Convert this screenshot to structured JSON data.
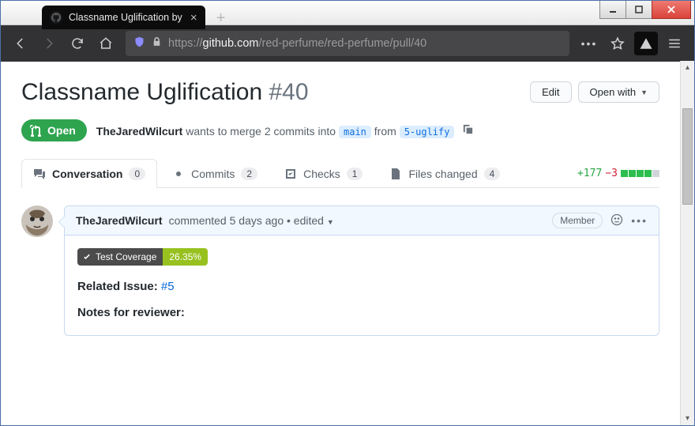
{
  "os_window": {
    "min_tip": "Minimize",
    "max_tip": "Maximize",
    "close_tip": "Close"
  },
  "browser": {
    "tab_title": "Classname Uglification by",
    "url_prefix": "https://",
    "url_host": "github.com",
    "url_path": "/red-perfume/red-perfume/pull/40"
  },
  "pr": {
    "title": "Classname Uglification",
    "number": "#40",
    "edit_label": "Edit",
    "openwith_label": "Open with",
    "state_label": "Open",
    "merge_author": "TheJaredWilcurt",
    "merge_text_1": " wants to merge 2 commits into ",
    "merge_base": "main",
    "merge_text_2": " from ",
    "merge_head": "5-uglify"
  },
  "tabs": {
    "conversation": {
      "label": "Conversation",
      "count": "0"
    },
    "commits": {
      "label": "Commits",
      "count": "2"
    },
    "checks": {
      "label": "Checks",
      "count": "1"
    },
    "files": {
      "label": "Files changed",
      "count": "4"
    },
    "additions": "+177",
    "deletions": "−3"
  },
  "comment": {
    "author": "TheJaredWilcurt",
    "meta_1": " commented ",
    "time": "5 days ago",
    "meta_2": " • edited ",
    "role": "Member",
    "coverage_label": "Test Coverage",
    "coverage_value": "26.35%",
    "related_lead": "Related Issue: ",
    "related_link": "#5",
    "notes_label": "Notes for reviewer:"
  }
}
